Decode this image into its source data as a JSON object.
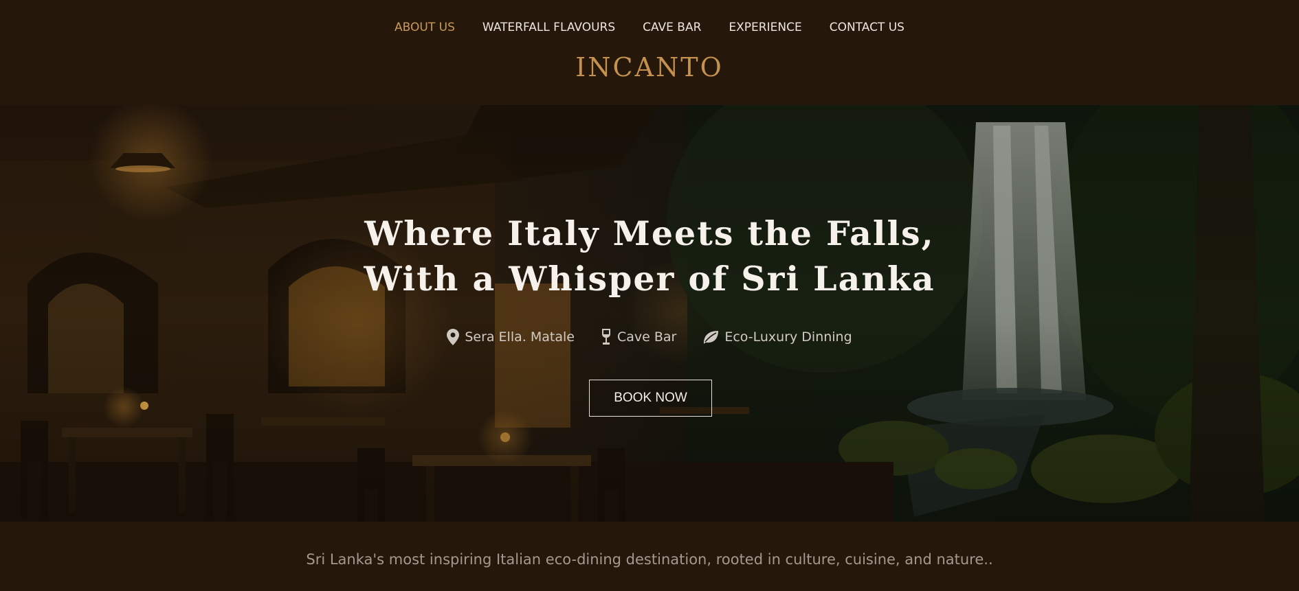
{
  "nav": {
    "items": [
      {
        "label": "ABOUT US",
        "active": true
      },
      {
        "label": "WATERFALL FLAVOURS",
        "active": false
      },
      {
        "label": "CAVE BAR",
        "active": false
      },
      {
        "label": "EXPERIENCE",
        "active": false
      },
      {
        "label": "CONTACT US",
        "active": false
      }
    ]
  },
  "brand": {
    "logo": "INCANTO",
    "accent": "#c4914f",
    "background": "#26170b"
  },
  "hero": {
    "title_line1": "Where Italy Meets the Falls,",
    "title_line2": "With a Whisper of Sri Lanka",
    "features": [
      {
        "icon": "map-pin-icon",
        "label": "Sera Ella. Matale"
      },
      {
        "icon": "wine-glass-icon",
        "label": "Cave Bar"
      },
      {
        "icon": "leaf-icon",
        "label": "Eco-Luxury Dinning"
      }
    ],
    "cta_label": "BOOK NOW"
  },
  "tagline": "Sri Lanka's most inspiring Italian eco-dining destination, rooted in culture, cuisine, and nature.."
}
